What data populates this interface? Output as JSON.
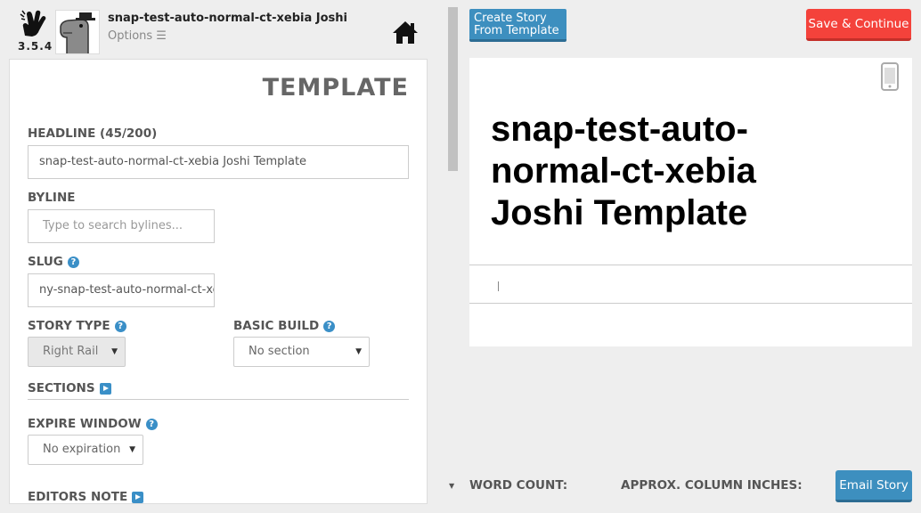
{
  "header": {
    "version": "3.5.4",
    "story_title": "snap-test-auto-normal-ct-xebia Joshi",
    "options_label": "Options ☰"
  },
  "form": {
    "heading": "TEMPLATE",
    "headline_label": "HEADLINE (45/200)",
    "headline_value": "snap-test-auto-normal-ct-xebia Joshi Template",
    "byline_label": "BYLINE",
    "byline_placeholder": "Type to search bylines...",
    "slug_label": "SLUG",
    "slug_value": "ny-snap-test-auto-normal-ct-xebia",
    "story_type_label": "STORY TYPE",
    "story_type_value": "Right Rail",
    "basic_build_label": "BASIC BUILD",
    "basic_build_value": "No section",
    "sections_label": "SECTIONS",
    "expire_label": "EXPIRE WINDOW",
    "expire_value": "No expiration",
    "editors_note_label": "EDITORS NOTE"
  },
  "actions": {
    "create_from_template_line1": "Create Story",
    "create_from_template_line2": "From Template",
    "save_continue": "Save & Continue",
    "email_story": "Email Story"
  },
  "preview": {
    "headline": "snap-test-auto-normal-ct-xebia Joshi Template"
  },
  "footer": {
    "word_count_label": "WORD COUNT:",
    "column_inches_label": "APPROX. COLUMN INCHES:"
  },
  "colors": {
    "accent_blue": "#3d8fbf",
    "save_red": "#f4423b"
  }
}
